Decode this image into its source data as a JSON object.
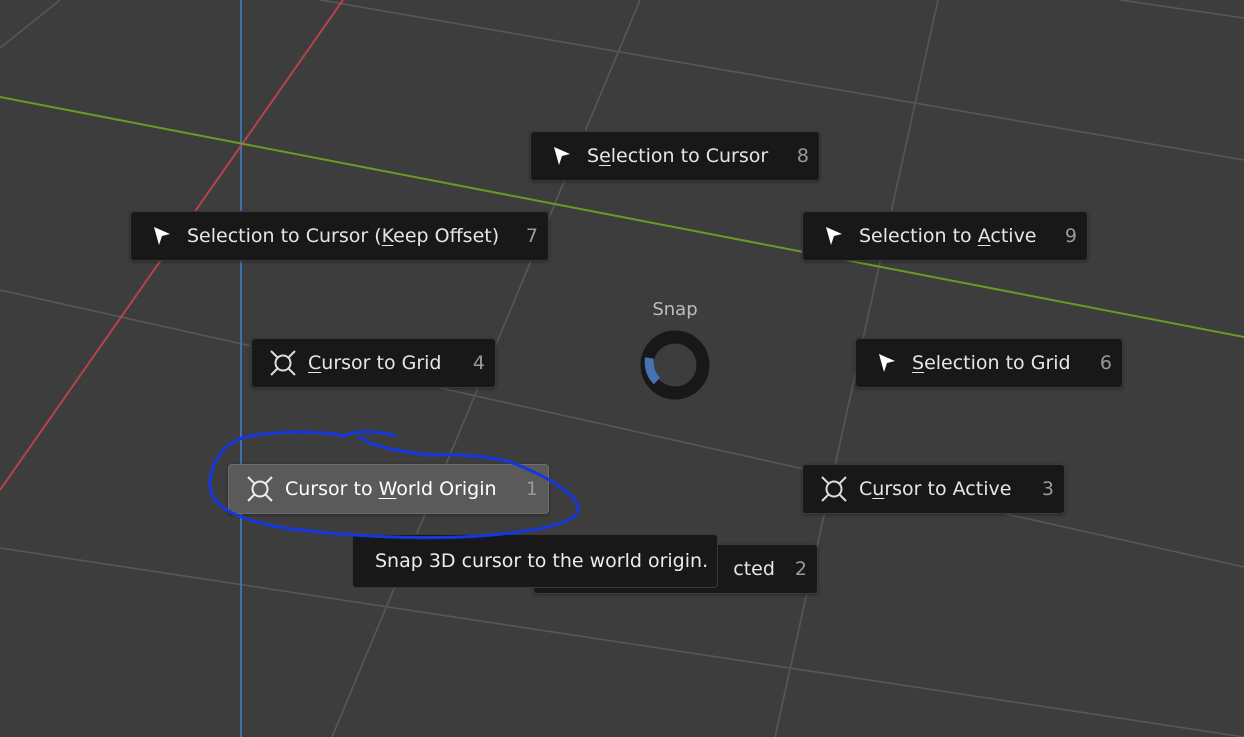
{
  "pie_menu": {
    "title": "Snap",
    "items": [
      {
        "id": "selection-to-cursor",
        "pre": "S",
        "ul": "e",
        "post": "lection to Cursor",
        "shortcut": "8",
        "icon": "cursor-arrow-icon",
        "active": false
      },
      {
        "id": "selection-to-cursor-keep-offset",
        "pre": "Selection to Cursor (",
        "ul": "K",
        "post": "eep Offset)",
        "shortcut": "7",
        "icon": "cursor-arrow-icon",
        "active": false
      },
      {
        "id": "selection-to-active",
        "pre": "Selection to ",
        "ul": "A",
        "post": "ctive",
        "shortcut": "9",
        "icon": "cursor-arrow-icon",
        "active": false
      },
      {
        "id": "cursor-to-grid",
        "pre": "",
        "ul": "C",
        "post": "ursor to Grid",
        "shortcut": "4",
        "icon": "3d-cursor-icon",
        "active": false
      },
      {
        "id": "selection-to-grid",
        "pre": "",
        "ul": "S",
        "post": "election to Grid",
        "shortcut": "6",
        "icon": "cursor-arrow-icon",
        "active": false
      },
      {
        "id": "cursor-to-world-origin",
        "pre": "Cursor to ",
        "ul": "W",
        "post": "orld Origin",
        "shortcut": "1",
        "icon": "3d-cursor-icon",
        "active": true
      },
      {
        "id": "cursor-to-active",
        "pre": "C",
        "ul": "u",
        "post": "rsor to Active",
        "shortcut": "3",
        "icon": "3d-cursor-icon",
        "active": false
      },
      {
        "id": "cursor-to-selected",
        "pre": "",
        "ul": "",
        "post": "cted",
        "shortcut": "2",
        "icon": "",
        "active": false
      }
    ]
  },
  "tooltip": {
    "text": "Snap 3D cursor to the world origin."
  },
  "colors": {
    "viewport_bg": "#3d3d3d",
    "grid_line": "#575757",
    "x_axis": "#b5434f",
    "y_axis": "#6a9a24",
    "z_axis": "#3f6fad",
    "item_bg": "#181818",
    "item_active_bg": "#5a5a5a",
    "pie_ring": "#181818",
    "pie_ring_indicator": "#4772b3",
    "annotation_scribble": "#1537e0"
  }
}
